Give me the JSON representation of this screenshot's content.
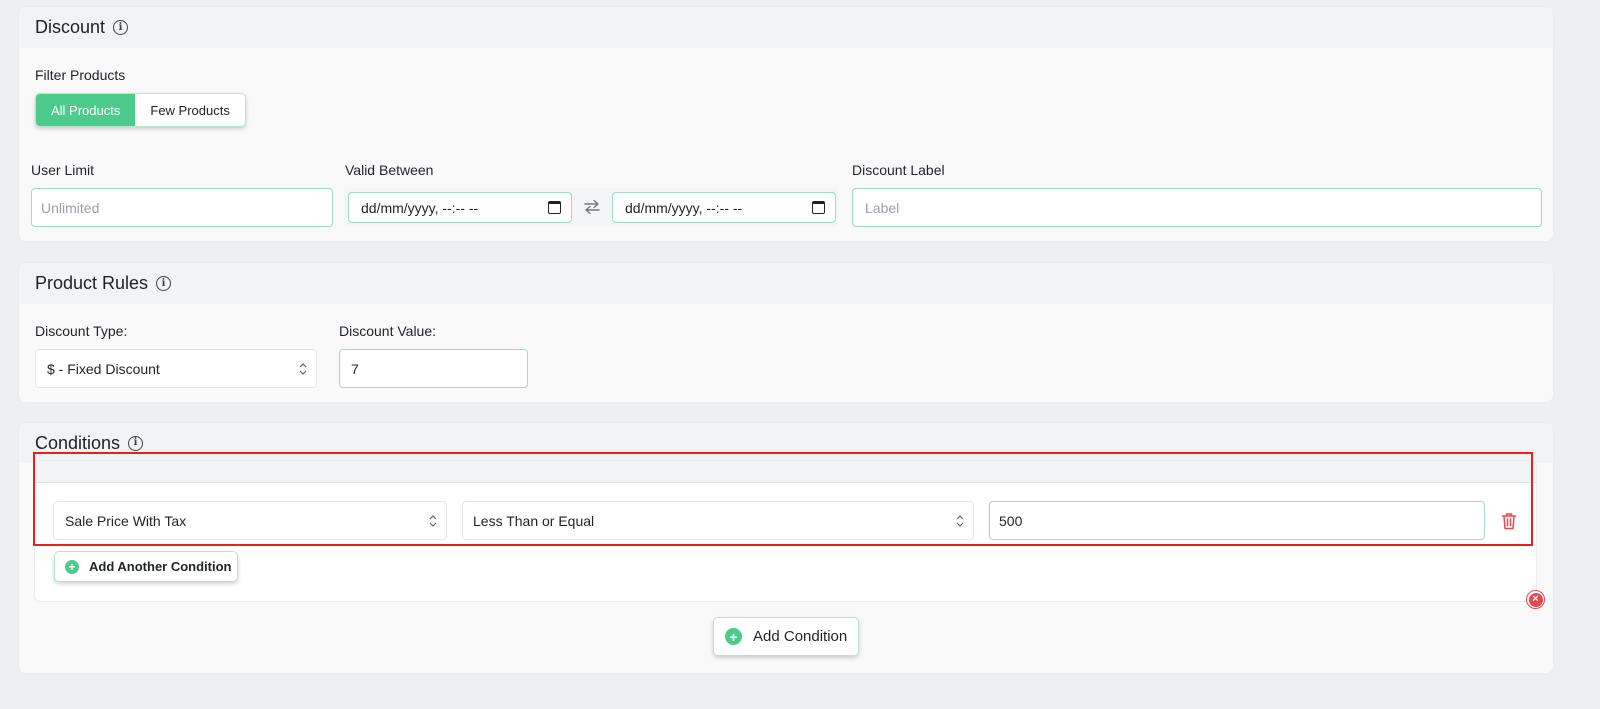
{
  "discount": {
    "title": "Discount",
    "filter_label": "Filter Products",
    "filter_options": [
      "All Products",
      "Few Products"
    ],
    "user_limit_label": "User Limit",
    "user_limit_placeholder": "Unlimited",
    "valid_between_label": "Valid Between",
    "date_from": "dd/mm/yyyy, --:-- --",
    "date_to": "dd/mm/yyyy, --:-- --",
    "discount_label_label": "Discount Label",
    "discount_label_placeholder": "Label"
  },
  "product_rules": {
    "title": "Product Rules",
    "type_label": "Discount Type:",
    "type_value": "$ - Fixed Discount",
    "value_label": "Discount Value:",
    "value": "7"
  },
  "conditions": {
    "title": "Conditions",
    "rows": [
      {
        "field": "Sale Price With Tax",
        "operator": "Less Than or Equal",
        "value": "500"
      }
    ],
    "add_another_label": "Add Another Condition",
    "add_condition_label": "Add Condition"
  },
  "colors": {
    "accent": "#4ccb8a",
    "danger": "#e5484d",
    "highlight": "#e8201e"
  },
  "icons": [
    "info-icon",
    "swap-arrows-icon",
    "calendar-icon",
    "updown-chevron-icon",
    "trash-icon",
    "plus-circle-icon",
    "close-circle-icon"
  ]
}
